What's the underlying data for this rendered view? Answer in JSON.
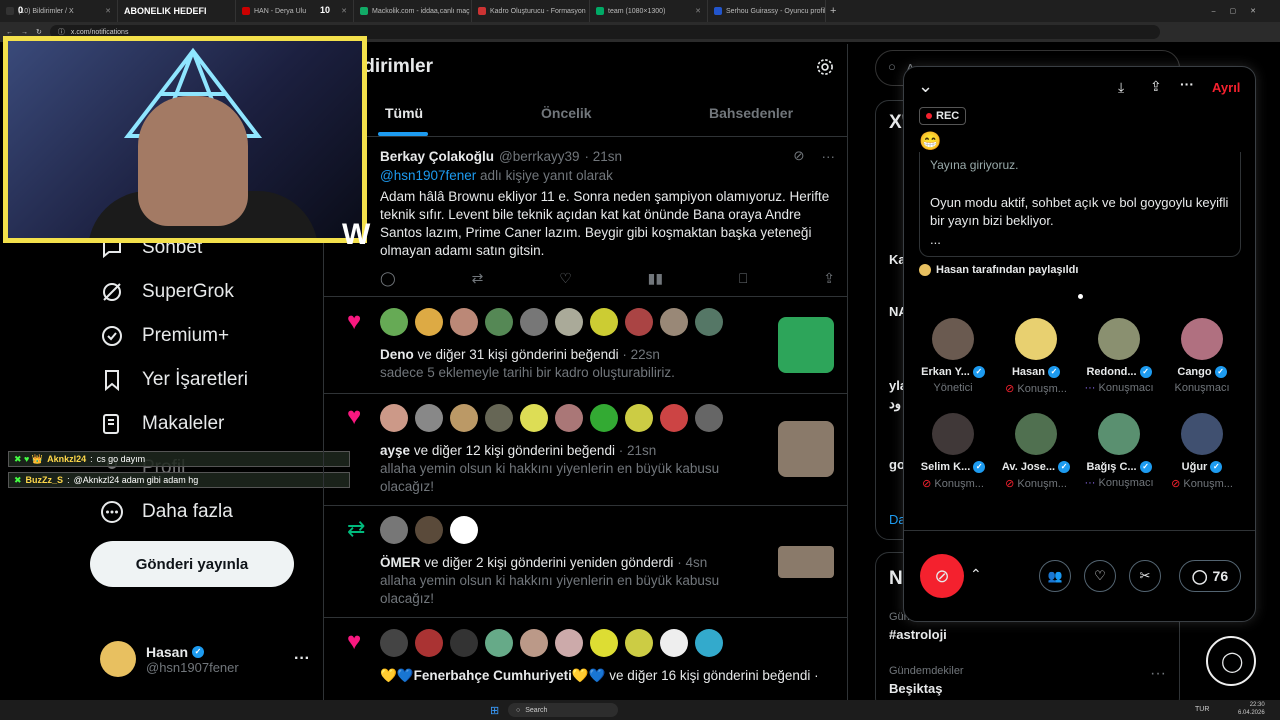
{
  "browser": {
    "tabs": [
      {
        "label": "(10) Bildirimler / X",
        "color": "#333"
      },
      {
        "label": "ABONELIK HEDEFI",
        "color": "#000"
      },
      {
        "label": "HAN - Derya Ulu",
        "color": "#c00"
      },
      {
        "label": "Mackolik.com - iddaa,canlı maç",
        "color": "#1a6"
      },
      {
        "label": "Kadro Oluşturucu - Formasyon",
        "color": "#c33"
      },
      {
        "label": "team (1080×1300)",
        "color": "#0a6"
      },
      {
        "label": "Serhou Guirassy - Oyuncu profil",
        "color": "#25c"
      }
    ],
    "overlay_counter_left": "0",
    "overlay_counter_mid": "10",
    "url": "x.com/notifications"
  },
  "sidebar": {
    "items": [
      {
        "label": "Sohbet"
      },
      {
        "label": "SuperGrok"
      },
      {
        "label": "Premium+"
      },
      {
        "label": "Yer İşaretleri"
      },
      {
        "label": "Makaleler"
      },
      {
        "label": "Profil"
      },
      {
        "label": "Daha fazla"
      }
    ],
    "post_button": "Gönderi yayınla",
    "profile_name": "Hasan",
    "profile_handle": "@hsn1907fener",
    "more_dots": "···"
  },
  "chat": [
    {
      "user": "Aknkzl24",
      "msg": "cs go dayım"
    },
    {
      "user": "BuzZz_S",
      "msg": "@Aknkzl24 adam gibi adam hg"
    }
  ],
  "main": {
    "title": "ldirimler",
    "tabs": [
      "Tümü",
      "Öncelik",
      "Bahsedenler"
    ],
    "reply": {
      "name": "Berkay Çolakoğlu",
      "handle": "@berrkayy39",
      "time": "· 21sn",
      "reply_to": "@hsn1907fener",
      "reply_note": "adlı kişiye yanıt olarak",
      "text": "Adam hâlâ Brownu ekliyor 11 e. Sonra neden şampiyon olamıyoruz. Herifte teknik sıfır. Levent bile teknik açıdan kat kat önünde Bana oraya Andre Santos lazım, Prime Caner lazım. Beygir gibi koşmaktan başka yeteneği olmayan adamı satın gitsin."
    },
    "notif1": {
      "who": "Deno",
      "rest": "ve diğer 31 kişi gönderini beğendi",
      "time": "· 22sn",
      "quote": "sadece 5 eklemeyle tarihi bir kadro oluşturabiliriz."
    },
    "notif2": {
      "who": "ayşe",
      "rest": "ve diğer 12 kişi gönderini beğendi",
      "time": "· 21sn",
      "quote": "allaha yemin olsun ki hakkını yiyenlerin en büyük kabusu olacağız!"
    },
    "notif3": {
      "who": "ÖMER",
      "rest": "ve diğer 2 kişi gönderini yeniden gönderdi",
      "time": "· 4sn",
      "quote": "allaha yemin olsun ki hakkını yiyenlerin en büyük kabusu olacağız!"
    },
    "notif4": {
      "who": "💛💙Fenerbahçe Cumhuriyeti💛💙",
      "rest": "ve diğer 16 kişi gönderini beğendi ·"
    }
  },
  "right": {
    "search_placeholder": "A",
    "panel_title": "X'",
    "frag": [
      "Ka",
      "NA",
      "yla",
      "ود",
      "go",
      "Da"
    ],
    "trends": [
      {
        "cat": "Gündemdekiler",
        "tag": "#astroloji"
      },
      {
        "cat": "Gündemdekiler",
        "tag": "Beşiktaş"
      }
    ],
    "panel2_title": "Ne"
  },
  "space": {
    "leave": "Ayrıl",
    "rec": "REC",
    "emoji": "😁",
    "desc_top": "Yayına giriyoruz.",
    "desc": "Oyun modu aktif, sohbet açık ve bol goygoylu keyifli bir yayın bizi bekliyor.",
    "ellipsis": "...",
    "shared_by": "Hasan tarafından paylaşıldı",
    "speakers": [
      {
        "name": "Erkan Y...",
        "role": "Yönetici",
        "color": "#6a5a50"
      },
      {
        "name": "Hasan",
        "role": "Konuşm...",
        "color": "#e8d070"
      },
      {
        "name": "Redond...",
        "role": "Konuşmacı",
        "color": "#8a9070"
      },
      {
        "name": "Cango",
        "role": "Konuşmacı",
        "color": "#b07080"
      },
      {
        "name": "Selim K...",
        "role": "Konuşm...",
        "color": "#403838"
      },
      {
        "name": "Av. Jose...",
        "role": "Konuşm...",
        "color": "#507050"
      },
      {
        "name": "Bağış C...",
        "role": "Konuşmacı",
        "color": "#5a9070"
      },
      {
        "name": "Uğur",
        "role": "Konuşm...",
        "color": "#405070"
      }
    ],
    "comment_count": "76"
  },
  "taskbar": {
    "search": "Search",
    "lang": "TUR",
    "time": "22:30",
    "date": "6.04.2026"
  }
}
